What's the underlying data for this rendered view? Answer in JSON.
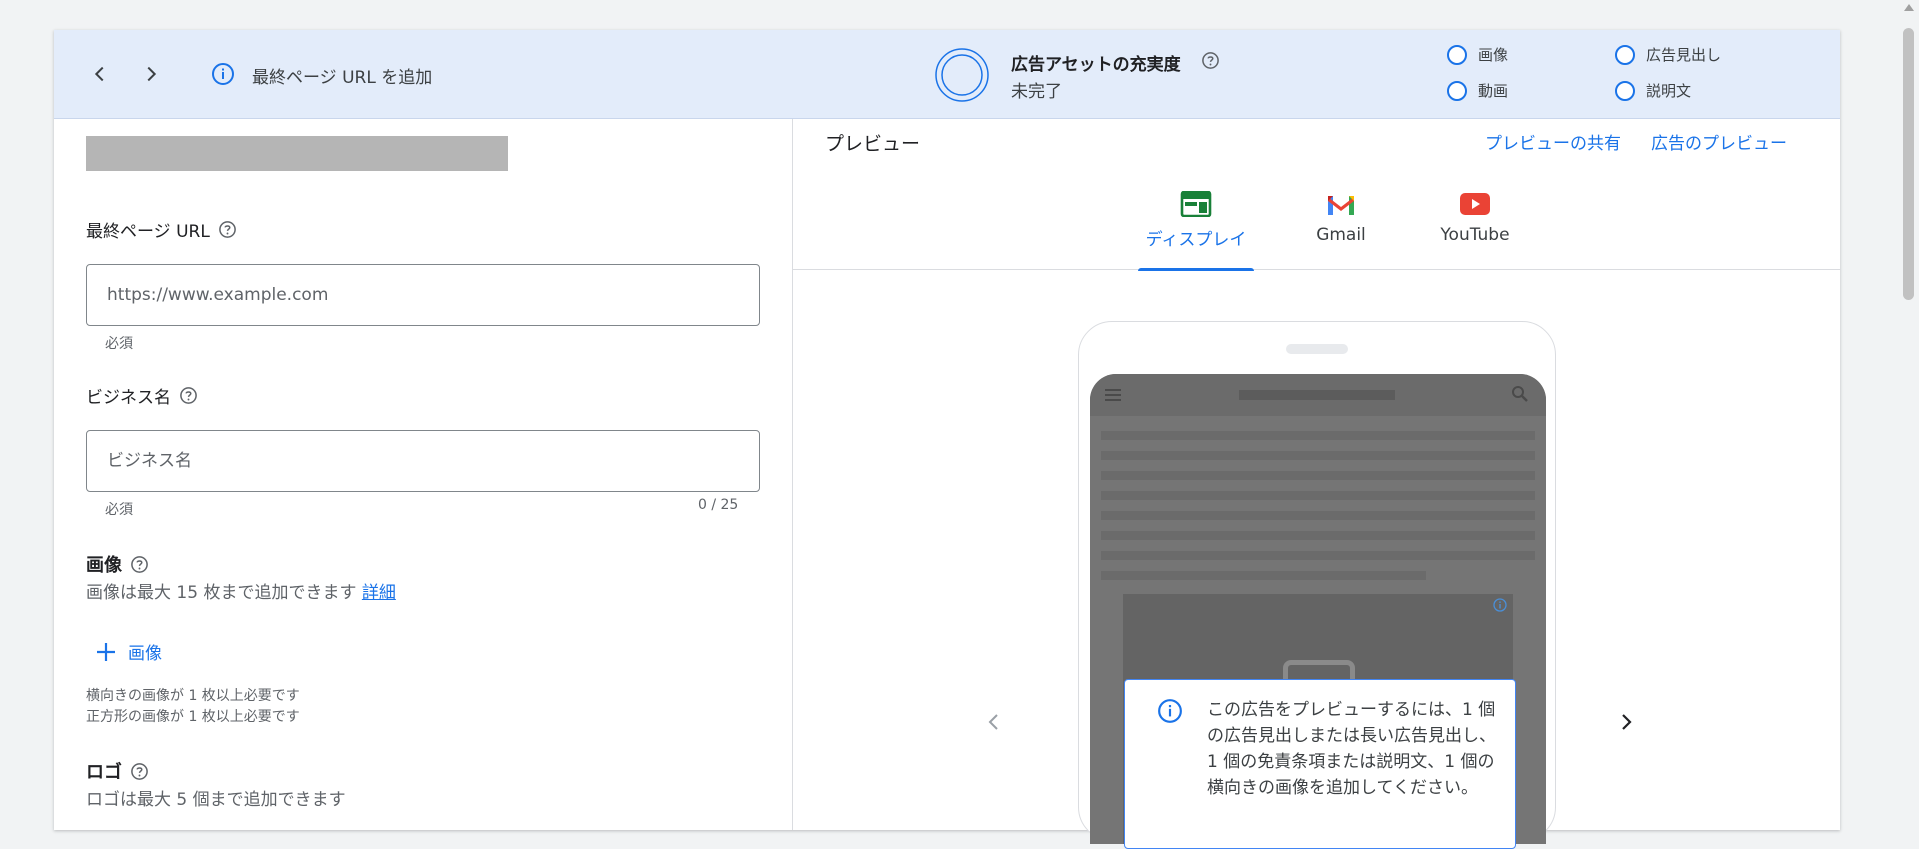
{
  "topbar": {
    "back_icon": "chevron-left-icon",
    "forward_icon": "chevron-right-icon",
    "info_icon": "info-icon",
    "message": "最終ページ URL を追加",
    "ad_strength": {
      "title": "広告アセットの充実度",
      "status": "未完了",
      "help_icon": "help-icon"
    },
    "checklist": [
      {
        "label": "画像"
      },
      {
        "label": "広告見出し"
      },
      {
        "label": "動画"
      },
      {
        "label": "説明文"
      }
    ]
  },
  "form": {
    "final_url": {
      "label": "最終ページ URL",
      "placeholder": "https://www.example.com",
      "hint": "必須"
    },
    "business_name": {
      "label": "ビジネス名",
      "placeholder": "ビジネス名",
      "hint": "必須",
      "counter": "0 / 25"
    },
    "images": {
      "title": "画像",
      "description": "画像は最大 15 枚まで追加できます",
      "details_link": "詳細",
      "add_label": "画像",
      "requirements": [
        "横向きの画像が 1 枚以上必要です",
        "正方形の画像が 1 枚以上必要です"
      ]
    },
    "logo": {
      "title": "ロゴ",
      "description": "ロゴは最大 5 個まで追加できます"
    }
  },
  "preview": {
    "title": "プレビュー",
    "share_link": "プレビューの共有",
    "ad_preview_link": "広告のプレビュー",
    "tabs": [
      {
        "label": "ディスプレイ",
        "icon": "display-icon",
        "active": true
      },
      {
        "label": "Gmail",
        "icon": "gmail-icon",
        "active": false
      },
      {
        "label": "YouTube",
        "icon": "youtube-icon",
        "active": false
      }
    ],
    "notice": "この広告をプレビューするには、1 個の広告見出しまたは長い広告見出し、1 個の免責条項または説明文、1 個の横向きの画像を追加してください。"
  },
  "colors": {
    "accent": "#1a73e8",
    "banner_bg": "#e3ecfa",
    "display_icon": "#188038",
    "youtube_red": "#ea4335"
  }
}
